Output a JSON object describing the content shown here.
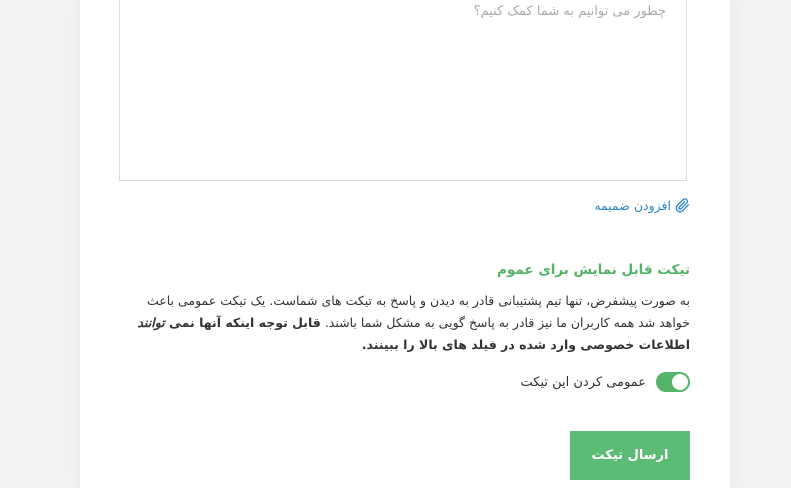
{
  "message": {
    "placeholder": "چطور می توانیم به شما کمک کنیم؟"
  },
  "attachment": {
    "label": "افزودن ضمیمه",
    "icon": "paperclip-icon"
  },
  "public_section": {
    "title": "تیکت قابل نمایش برای عموم",
    "desc_part1": "به صورت پیشفرض، تنها تیم پشتیبانی قادر به دیدن و پاسخ به تیکت های شماست. یک تیکت عمومی باعث خواهد شد همه کاربران ما نیز قادر به پاسخ گویی به مشکل شما باشند. ",
    "desc_bold1": "قابل توجه اینکه آنها نمی ",
    "desc_italic": "توانند",
    "desc_bold2": " اطلاعات خصوصی وارد شده در فیلد های بالا را ببینند."
  },
  "toggle": {
    "label": "عمومی کردن این تیکت",
    "enabled": true,
    "color": "#55b36a"
  },
  "submit": {
    "label": "ارسال تیکت",
    "color": "#5cbb75"
  }
}
